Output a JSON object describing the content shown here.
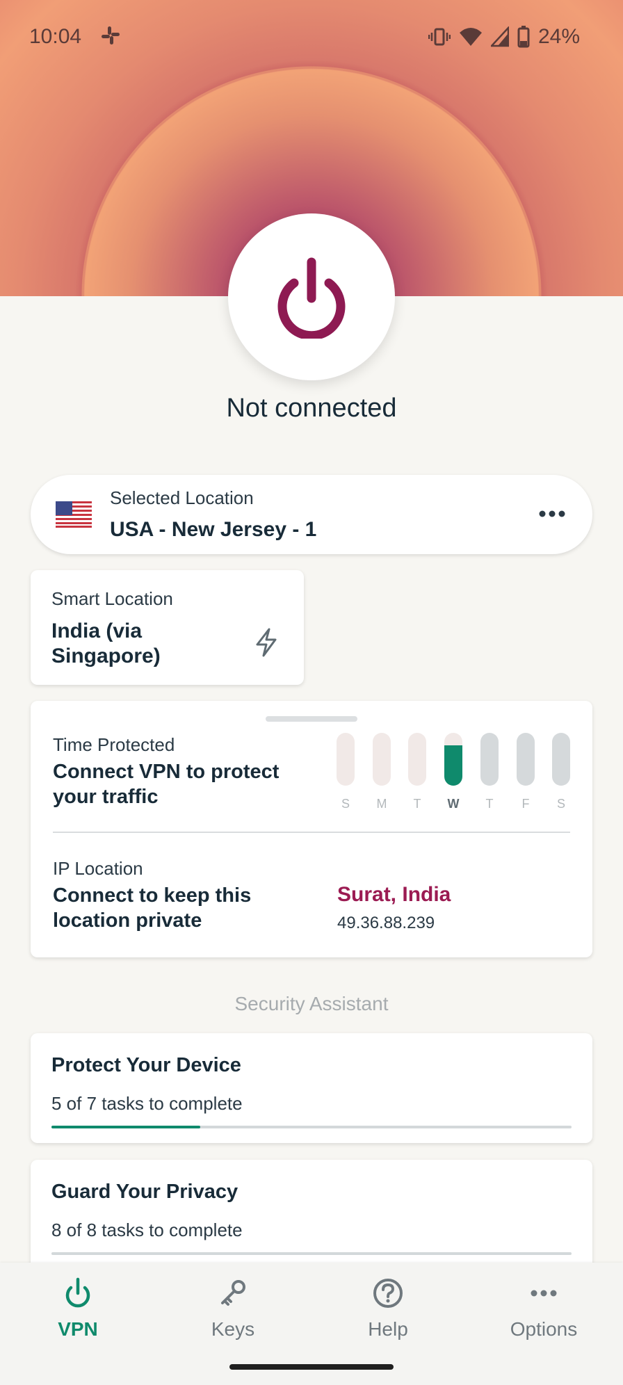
{
  "status_bar": {
    "time": "10:04",
    "battery": "24%"
  },
  "main": {
    "connection_status": "Not connected"
  },
  "selected_location": {
    "label": "Selected Location",
    "value": "USA - New Jersey - 1"
  },
  "smart_location": {
    "label": "Smart Location",
    "value": "India (via Singapore)"
  },
  "time_protected": {
    "label": "Time Protected",
    "value": "Connect VPN to protect your traffic",
    "days": [
      "S",
      "M",
      "T",
      "W",
      "T",
      "F",
      "S"
    ],
    "current_day_index": 3
  },
  "ip_location": {
    "label": "IP Location",
    "value": "Connect to keep this location private",
    "city": "Surat, India",
    "address": "49.36.88.239"
  },
  "security_assistant": {
    "heading": "Security Assistant",
    "tasks": [
      {
        "title": "Protect Your Device",
        "subtitle": "5 of 7 tasks to complete",
        "progress": 0.286
      },
      {
        "title": "Guard Your Privacy",
        "subtitle": "8 of 8 tasks to complete",
        "progress": 0
      }
    ]
  },
  "bottom_nav": {
    "items": [
      {
        "label": "VPN",
        "icon": "power-icon",
        "active": true
      },
      {
        "label": "Keys",
        "icon": "key-icon",
        "active": false
      },
      {
        "label": "Help",
        "icon": "help-icon",
        "active": false
      },
      {
        "label": "Options",
        "icon": "more-icon",
        "active": false
      }
    ]
  },
  "colors": {
    "accent_green": "#0f8a6c",
    "power_magenta": "#8e1a52",
    "city_red": "#9b1b52",
    "hero_orange": "#f19e76"
  }
}
